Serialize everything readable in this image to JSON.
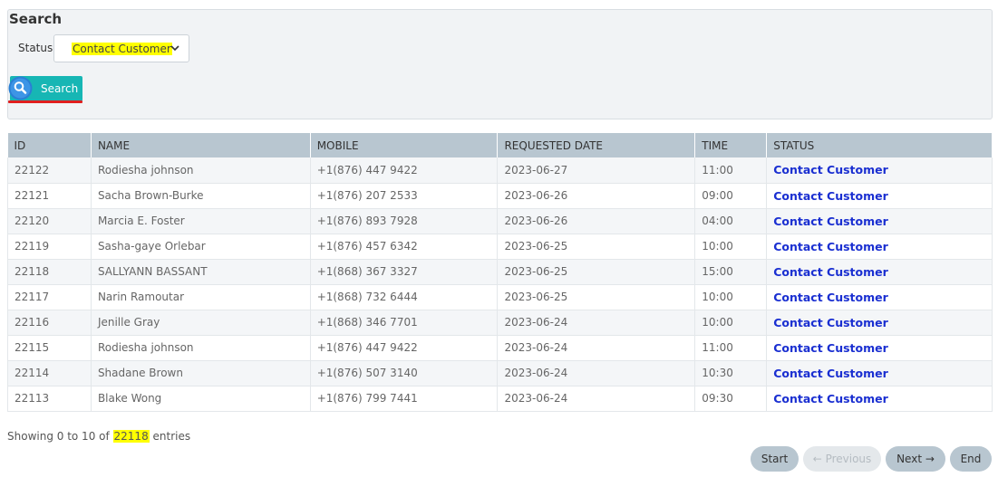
{
  "search": {
    "title": "Search",
    "status_label": "Status:",
    "status_value": "Contact Customer",
    "button_label": "Search"
  },
  "table": {
    "headers": [
      "ID",
      "NAME",
      "MOBILE",
      "REQUESTED DATE",
      "TIME",
      "STATUS"
    ],
    "rows": [
      [
        "22122",
        "Rodiesha johnson",
        "+1(876) 447 9422",
        "2023-06-27",
        "11:00",
        "Contact Customer"
      ],
      [
        "22121",
        "Sacha Brown-Burke",
        "+1(876) 207 2533",
        "2023-06-26",
        "09:00",
        "Contact Customer"
      ],
      [
        "22120",
        "Marcia E. Foster",
        "+1(876) 893 7928",
        "2023-06-26",
        "04:00",
        "Contact Customer"
      ],
      [
        "22119",
        "Sasha-gaye Orlebar",
        "+1(876) 457 6342",
        "2023-06-25",
        "10:00",
        "Contact Customer"
      ],
      [
        "22118",
        "SALLYANN BASSANT",
        "+1(868) 367 3327",
        "2023-06-25",
        "15:00",
        "Contact Customer"
      ],
      [
        "22117",
        "Narin Ramoutar",
        "+1(868) 732 6444",
        "2023-06-25",
        "10:00",
        "Contact Customer"
      ],
      [
        "22116",
        "Jenille Gray",
        "+1(868) 346 7701",
        "2023-06-24",
        "10:00",
        "Contact Customer"
      ],
      [
        "22115",
        "Rodiesha johnson",
        "+1(876) 447 9422",
        "2023-06-24",
        "11:00",
        "Contact Customer"
      ],
      [
        "22114",
        "Shadane Brown",
        "+1(876) 507 3140",
        "2023-06-24",
        "10:30",
        "Contact Customer"
      ],
      [
        "22113",
        "Blake Wong",
        "+1(876) 799 7441",
        "2023-06-24",
        "09:30",
        "Contact Customer"
      ]
    ]
  },
  "footer": {
    "entries_prefix": "Showing 0 to 10 of ",
    "entries_total": "22118",
    "entries_suffix": " entries"
  },
  "pagination": {
    "start": "Start",
    "previous": "← Previous",
    "next": "Next →",
    "end": "End"
  },
  "colors": {
    "accent": "#17b6b4",
    "header_bg": "#b8c6d0",
    "status_link": "#1a2fd1",
    "highlight": "#ffff00",
    "underline": "#e01f1f"
  }
}
